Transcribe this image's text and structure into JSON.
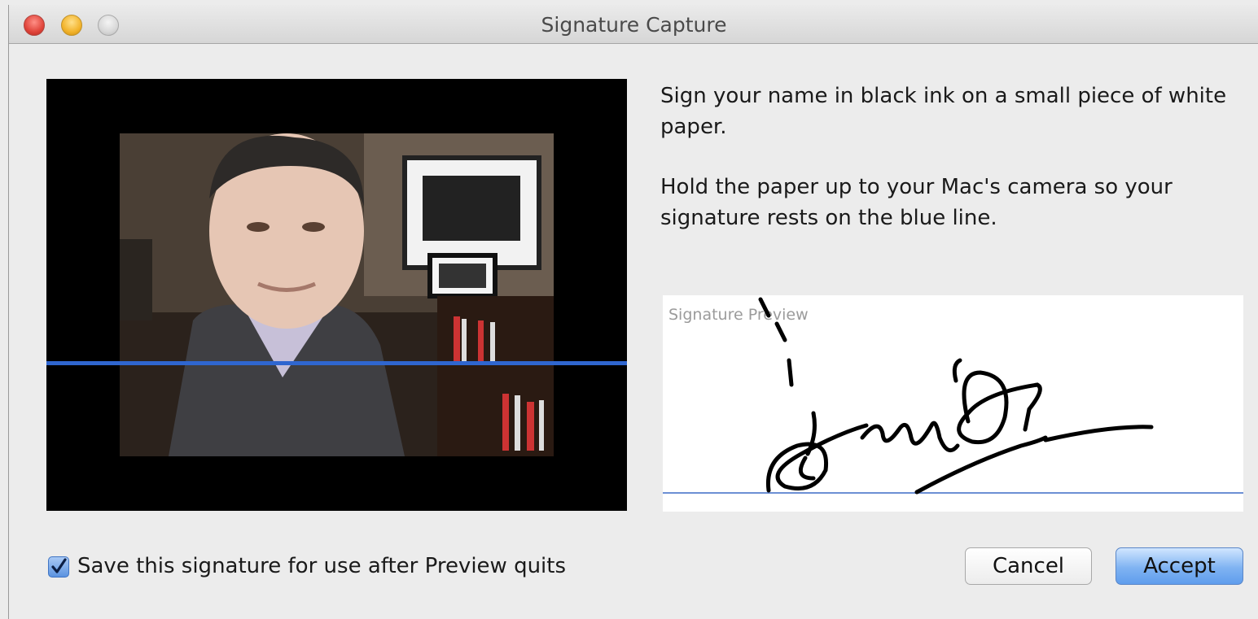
{
  "window": {
    "title": "Signature Capture"
  },
  "camera_view": {
    "icon": "camera-feed-image",
    "guide_color": "#2f66cf"
  },
  "instructions": {
    "line1": "Sign your name in black ink on a small piece of white paper.",
    "line2": "Hold the paper up to your Mac's camera so your signature rests on the blue line."
  },
  "preview": {
    "label": "Signature Preview"
  },
  "save_option": {
    "checked": true,
    "label": "Save this signature for use after Preview quits"
  },
  "buttons": {
    "cancel": "Cancel",
    "accept": "Accept"
  },
  "colors": {
    "accent": "#5f9ded",
    "signature_line": "#6c8fd4"
  }
}
